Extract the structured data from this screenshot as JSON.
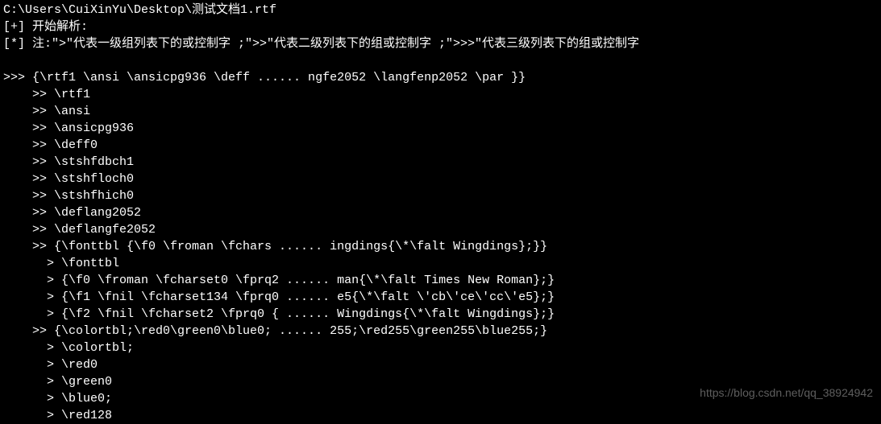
{
  "lines": [
    "C:\\Users\\CuiXinYu\\Desktop\\测试文档1.rtf",
    "[+] 开始解析:",
    "[*] 注:\">\"代表一级组列表下的或控制字 ;\">>\"代表二级列表下的组或控制字 ;\">>>\"代表三级列表下的组或控制字",
    "",
    ">>> {\\rtf1 \\ansi \\ansicpg936 \\deff ...... ngfe2052 \\langfenp2052 \\par }}",
    "    >> \\rtf1",
    "    >> \\ansi",
    "    >> \\ansicpg936",
    "    >> \\deff0",
    "    >> \\stshfdbch1",
    "    >> \\stshfloch0",
    "    >> \\stshfhich0",
    "    >> \\deflang2052",
    "    >> \\deflangfe2052",
    "    >> {\\fonttbl {\\f0 \\froman \\fchars ...... ingdings{\\*\\falt Wingdings};}}",
    "      > \\fonttbl",
    "      > {\\f0 \\froman \\fcharset0 \\fprq2 ...... man{\\*\\falt Times New Roman};}",
    "      > {\\f1 \\fnil \\fcharset134 \\fprq0 ...... e5{\\*\\falt \\'cb\\'ce\\'cc\\'e5};}",
    "      > {\\f2 \\fnil \\fcharset2 \\fprq0 { ...... Wingdings{\\*\\falt Wingdings};}",
    "    >> {\\colortbl;\\red0\\green0\\blue0; ...... 255;\\red255\\green255\\blue255;}",
    "      > \\colortbl;",
    "      > \\red0",
    "      > \\green0",
    "      > \\blue0;",
    "      > \\red128"
  ],
  "watermark": "https://blog.csdn.net/qq_38924942"
}
